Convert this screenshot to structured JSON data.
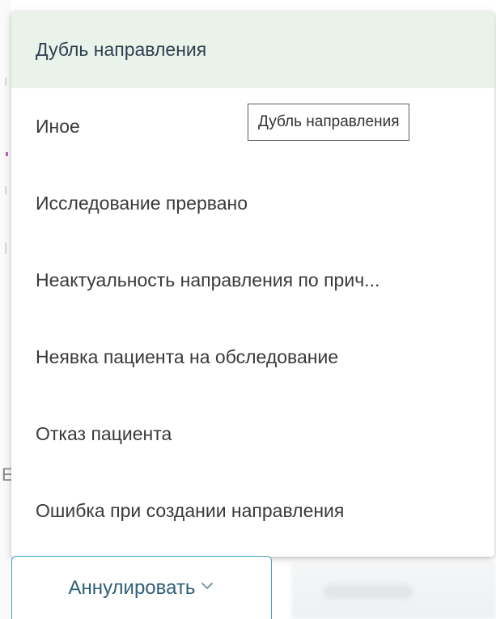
{
  "dropdown": {
    "items": [
      {
        "label": "Дубль направления",
        "selected": true
      },
      {
        "label": "Иное",
        "selected": false
      },
      {
        "label": "Исследование прервано",
        "selected": false
      },
      {
        "label": "Неактуальность направления по прич...",
        "selected": false
      },
      {
        "label": "Неявка пациента на обследование",
        "selected": false
      },
      {
        "label": "Отказ пациента",
        "selected": false
      },
      {
        "label": "Ошибка при создании направления",
        "selected": false
      }
    ]
  },
  "tooltip": {
    "text": "Дубль направления"
  },
  "action": {
    "annul_label": "Аннулировать",
    "icon": "chevron-down-icon"
  },
  "colors": {
    "selected_bg": "#eaf3ea",
    "button_border": "#4aa3c7",
    "button_text": "#2f5f78"
  }
}
